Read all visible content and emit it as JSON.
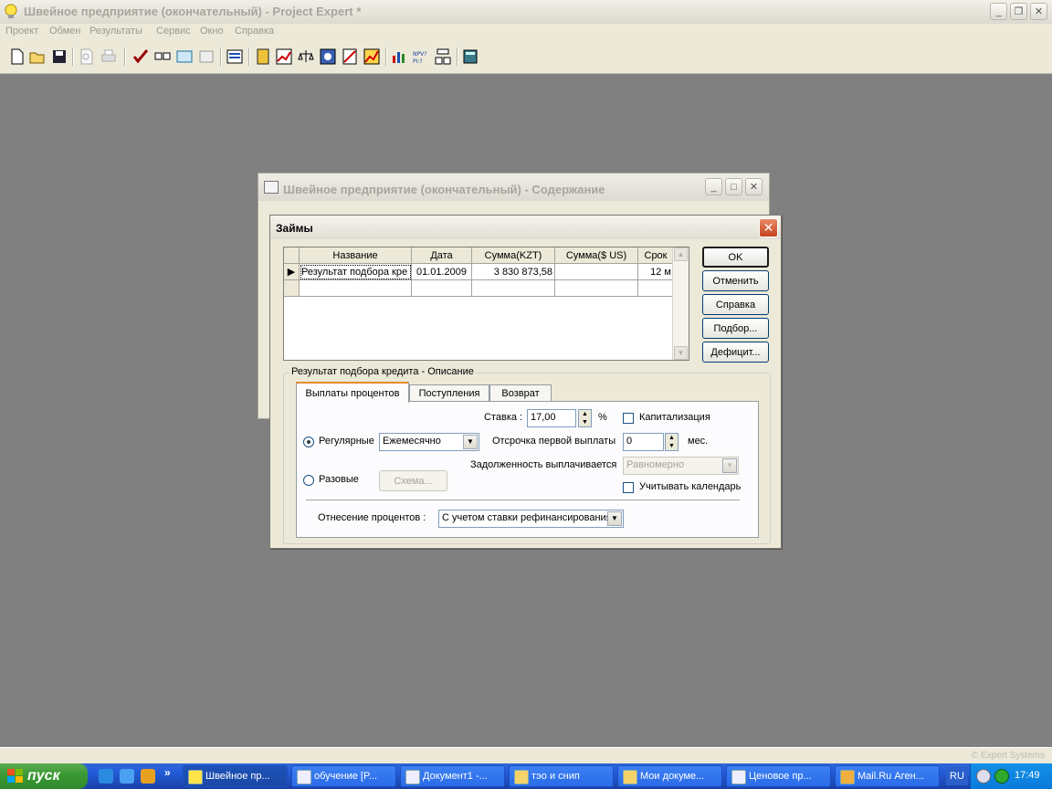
{
  "app": {
    "title": "Швейное предприятие (окончательный) - Project Expert *",
    "menu": [
      "Проект",
      "Обмен",
      "Результаты",
      "Сервис",
      "Окно",
      "Справка"
    ],
    "status_copyright": "© Expert Systems"
  },
  "bg_window": {
    "title": "Швейное предприятие (окончательный) - Содержание"
  },
  "dialog": {
    "title": "Займы",
    "columns": [
      "Название",
      "Дата",
      "Сумма(KZT)",
      "Сумма($ US)",
      "Срок"
    ],
    "rows": [
      [
        "Результат подбора кре",
        "01.01.2009",
        "3 830 873,58",
        "",
        "12 м"
      ]
    ],
    "buttons": {
      "ok": "OK",
      "cancel": "Отменить",
      "help": "Справка",
      "select": "Подбор...",
      "deficit": "Дефицит..."
    },
    "group_legend": "Результат подбора кредита - Описание",
    "tabs": [
      "Выплаты процентов",
      "Поступления",
      "Возврат"
    ],
    "rate_label": "Ставка :",
    "rate_value": "17,00",
    "rate_unit": "%",
    "capitalization_label": "Капитализация",
    "regular_label": "Регулярные",
    "regular_period": "Ежемесячно",
    "first_payment_delay_label": "Отсрочка первой выплаты",
    "first_payment_delay_value": "0",
    "first_payment_delay_unit": "мес.",
    "debt_paid_label": "Задолженность выплачивается",
    "debt_paid_value": "Равномерно",
    "one_time_label": "Разовые",
    "scheme_button": "Схема...",
    "calendar_label": "Учитывать календарь",
    "interest_attribution_label": "Отнесение процентов :",
    "interest_attribution_value": "С учетом ставки рефинансирования"
  },
  "taskbar": {
    "start_label": "пуск",
    "tasks": [
      "Швейное пр...",
      "обучение [P...",
      "Документ1 -...",
      "тэо и снип",
      "Мои докуме...",
      "Ценовое пр...",
      "Mail.Ru Аген..."
    ],
    "language": "RU",
    "clock": "17:49"
  }
}
